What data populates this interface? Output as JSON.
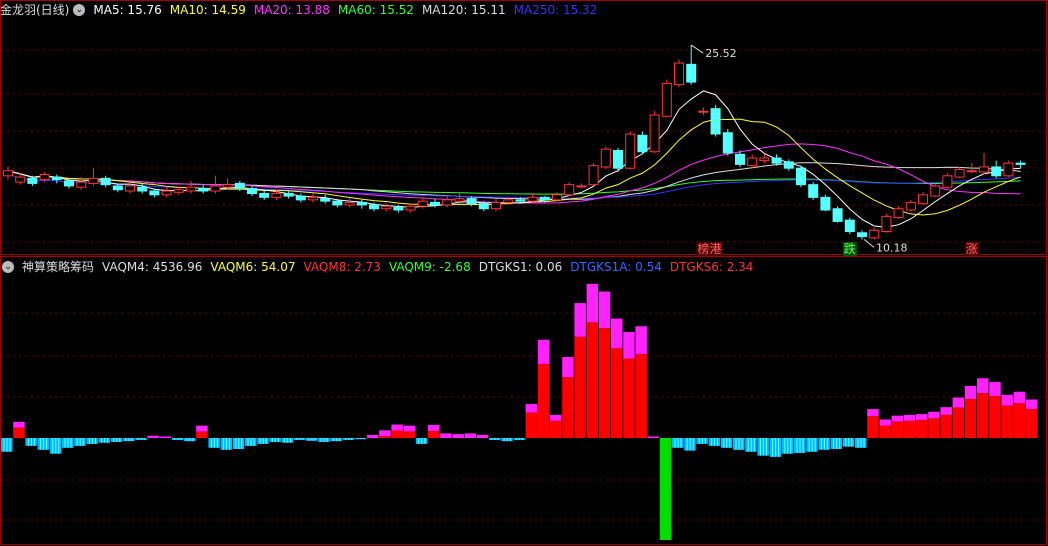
{
  "main": {
    "name": "金龙羽(日线)",
    "ma_labels": [
      {
        "text": "MA5: 15.76",
        "color": "#ffffff"
      },
      {
        "text": "MA10: 14.59",
        "color": "#ffff33"
      },
      {
        "text": "MA20: 13.88",
        "color": "#ff33ff"
      },
      {
        "text": "MA60: 15.52",
        "color": "#33ff33"
      },
      {
        "text": "MA120: 15.11",
        "color": "#dddddd"
      },
      {
        "text": "MA250: 15.32",
        "color": "#3333ff"
      }
    ]
  },
  "sub": {
    "name": "神算策略筹码",
    "labels": [
      {
        "text": "VAQM4: 4536.96",
        "color": "#dddddd"
      },
      {
        "text": "VAQM6: 54.07",
        "color": "#ffff33"
      },
      {
        "text": "VAQM8: 2.73",
        "color": "#ff3333"
      },
      {
        "text": "VAQM9: -2.68",
        "color": "#33ff33"
      },
      {
        "text": "DTGKS1: 0.06",
        "color": "#dddddd"
      },
      {
        "text": "DTGKS1A: 0.54",
        "color": "#3366ff"
      },
      {
        "text": "DTGKS6: 2.34",
        "color": "#ff3333"
      }
    ]
  },
  "chart_data": [
    {
      "type": "candlestick",
      "ylim": [
        9.5,
        27.5
      ],
      "high_label": "25.52",
      "low_label": "10.18",
      "candles": [
        [
          15.2,
          15.6,
          15.9,
          14.9
        ],
        [
          14.7,
          15.1,
          15.4,
          14.5
        ],
        [
          15.0,
          14.6,
          15.2,
          14.4
        ],
        [
          14.9,
          15.3,
          15.5,
          14.7
        ],
        [
          15.1,
          14.9,
          15.3,
          14.6
        ],
        [
          14.8,
          14.4,
          15.0,
          14.2
        ],
        [
          14.3,
          14.7,
          15.1,
          14.1
        ],
        [
          14.6,
          15.0,
          15.8,
          14.4
        ],
        [
          15.0,
          14.5,
          15.2,
          14.3
        ],
        [
          14.4,
          14.1,
          14.6,
          13.9
        ],
        [
          14.0,
          14.4,
          14.7,
          13.8
        ],
        [
          14.3,
          14.0,
          14.6,
          13.8
        ],
        [
          14.0,
          13.7,
          14.2,
          13.5
        ],
        [
          13.7,
          14.0,
          14.3,
          13.5
        ],
        [
          13.9,
          14.1,
          14.4,
          13.7
        ],
        [
          14.0,
          14.3,
          14.8,
          13.8
        ],
        [
          14.2,
          14.0,
          14.5,
          13.8
        ],
        [
          14.0,
          14.4,
          15.2,
          13.8
        ],
        [
          14.3,
          14.5,
          15.0,
          14.1
        ],
        [
          14.6,
          14.2,
          14.8,
          14.0
        ],
        [
          14.2,
          13.8,
          14.4,
          13.6
        ],
        [
          13.8,
          13.5,
          14.0,
          13.3
        ],
        [
          13.5,
          13.8,
          14.1,
          13.3
        ],
        [
          13.8,
          13.6,
          14.0,
          13.4
        ],
        [
          13.6,
          13.3,
          13.8,
          13.1
        ],
        [
          13.3,
          13.5,
          13.8,
          13.1
        ],
        [
          13.4,
          13.2,
          13.7,
          13.0
        ],
        [
          13.2,
          12.9,
          13.4,
          12.7
        ],
        [
          12.9,
          13.1,
          13.4,
          12.7
        ],
        [
          13.1,
          12.9,
          13.3,
          12.6
        ],
        [
          12.9,
          12.6,
          13.1,
          12.4
        ],
        [
          12.6,
          12.8,
          13.0,
          12.4
        ],
        [
          12.7,
          12.5,
          12.9,
          12.3
        ],
        [
          12.5,
          12.8,
          13.0,
          12.3
        ],
        [
          12.8,
          13.2,
          13.5,
          12.6
        ],
        [
          13.1,
          12.9,
          13.4,
          12.7
        ],
        [
          12.9,
          13.3,
          13.7,
          12.7
        ],
        [
          13.2,
          13.4,
          13.8,
          13.0
        ],
        [
          13.4,
          13.0,
          13.6,
          12.8
        ],
        [
          13.0,
          12.6,
          13.2,
          12.4
        ],
        [
          12.6,
          13.1,
          13.4,
          12.4
        ],
        [
          13.1,
          13.3,
          13.5,
          12.9
        ],
        [
          13.3,
          13.2,
          13.5,
          13.0
        ],
        [
          13.2,
          13.5,
          13.8,
          13.0
        ],
        [
          13.5,
          13.3,
          13.6,
          13.1
        ],
        [
          13.3,
          13.7,
          13.9,
          13.2
        ],
        [
          13.7,
          14.5,
          14.7,
          13.6
        ],
        [
          14.4,
          14.4,
          14.6,
          14.2
        ],
        [
          14.5,
          16.0,
          16.2,
          14.4
        ],
        [
          15.9,
          17.3,
          17.5,
          15.7
        ],
        [
          17.2,
          15.8,
          17.4,
          15.5
        ],
        [
          15.8,
          18.5,
          18.7,
          15.7
        ],
        [
          18.4,
          17.1,
          18.7,
          16.9
        ],
        [
          17.1,
          20.0,
          20.3,
          17.0
        ],
        [
          19.9,
          22.5,
          22.8,
          19.8
        ],
        [
          22.4,
          24.1,
          24.4,
          22.2
        ],
        [
          24.0,
          22.6,
          25.52,
          22.4
        ],
        [
          20.3,
          20.3,
          20.6,
          20.0
        ],
        [
          20.5,
          18.5,
          20.8,
          18.3
        ],
        [
          18.6,
          17.0,
          18.9,
          16.8
        ],
        [
          16.9,
          16.1,
          17.2,
          15.9
        ],
        [
          16.0,
          16.6,
          16.9,
          15.8
        ],
        [
          16.4,
          16.6,
          16.9,
          16.2
        ],
        [
          16.6,
          16.2,
          16.9,
          16.0
        ],
        [
          16.3,
          15.8,
          16.5,
          15.6
        ],
        [
          15.8,
          14.5,
          16.0,
          14.3
        ],
        [
          14.5,
          13.5,
          14.7,
          13.3
        ],
        [
          13.5,
          12.5,
          13.7,
          12.4
        ],
        [
          12.6,
          11.6,
          12.8,
          11.5
        ],
        [
          11.7,
          10.8,
          11.9,
          10.6
        ],
        [
          10.7,
          10.4,
          10.9,
          10.18
        ],
        [
          10.3,
          10.9,
          11.1,
          10.18
        ],
        [
          10.8,
          12.0,
          12.2,
          10.7
        ],
        [
          11.9,
          12.6,
          12.8,
          11.8
        ],
        [
          12.5,
          13.1,
          13.3,
          12.4
        ],
        [
          13.0,
          13.7,
          13.9,
          12.9
        ],
        [
          13.6,
          14.4,
          14.6,
          13.5
        ],
        [
          14.3,
          15.2,
          15.4,
          14.2
        ],
        [
          15.1,
          15.7,
          15.9,
          15.0
        ],
        [
          15.6,
          15.6,
          16.2,
          15.4
        ],
        [
          15.5,
          15.9,
          17.0,
          15.3
        ],
        [
          15.9,
          15.2,
          16.4,
          15.0
        ],
        [
          15.2,
          16.2,
          16.4,
          15.1
        ],
        [
          16.2,
          16.1,
          16.4,
          15.8
        ]
      ],
      "markers": [
        {
          "text": "榜",
          "index": 57
        },
        {
          "text": "港",
          "index": 58
        },
        {
          "text": "跌",
          "index": 69
        },
        {
          "text": "涨",
          "index": 79
        }
      ]
    },
    {
      "type": "bar",
      "ylim": [
        -2.6,
        4.1
      ],
      "values": [
        -0.35,
        0.42,
        -0.2,
        -0.3,
        -0.4,
        -0.25,
        -0.2,
        -0.15,
        -0.12,
        -0.1,
        -0.08,
        -0.05,
        0.06,
        0.04,
        -0.05,
        -0.08,
        0.32,
        -0.25,
        -0.3,
        -0.28,
        -0.2,
        -0.15,
        -0.1,
        -0.12,
        -0.05,
        -0.07,
        -0.1,
        -0.08,
        -0.05,
        -0.03,
        0.08,
        0.2,
        0.35,
        0.32,
        -0.15,
        0.34,
        0.12,
        0.1,
        0.12,
        0.08,
        -0.05,
        -0.08,
        -0.05,
        0.88,
        2.55,
        0.6,
        2.1,
        3.5,
        4.0,
        3.8,
        3.1,
        2.75,
        2.9,
        0.04,
        -2.6,
        -0.25,
        -0.32,
        -0.15,
        -0.2,
        -0.25,
        -0.3,
        -0.35,
        -0.45,
        -0.48,
        -0.4,
        -0.38,
        -0.35,
        -0.3,
        -0.28,
        -0.22,
        -0.25,
        0.75,
        0.48,
        0.58,
        0.6,
        0.62,
        0.68,
        0.8,
        1.05,
        1.35,
        1.55,
        1.45,
        1.12,
        1.2,
        1.0
      ]
    }
  ]
}
